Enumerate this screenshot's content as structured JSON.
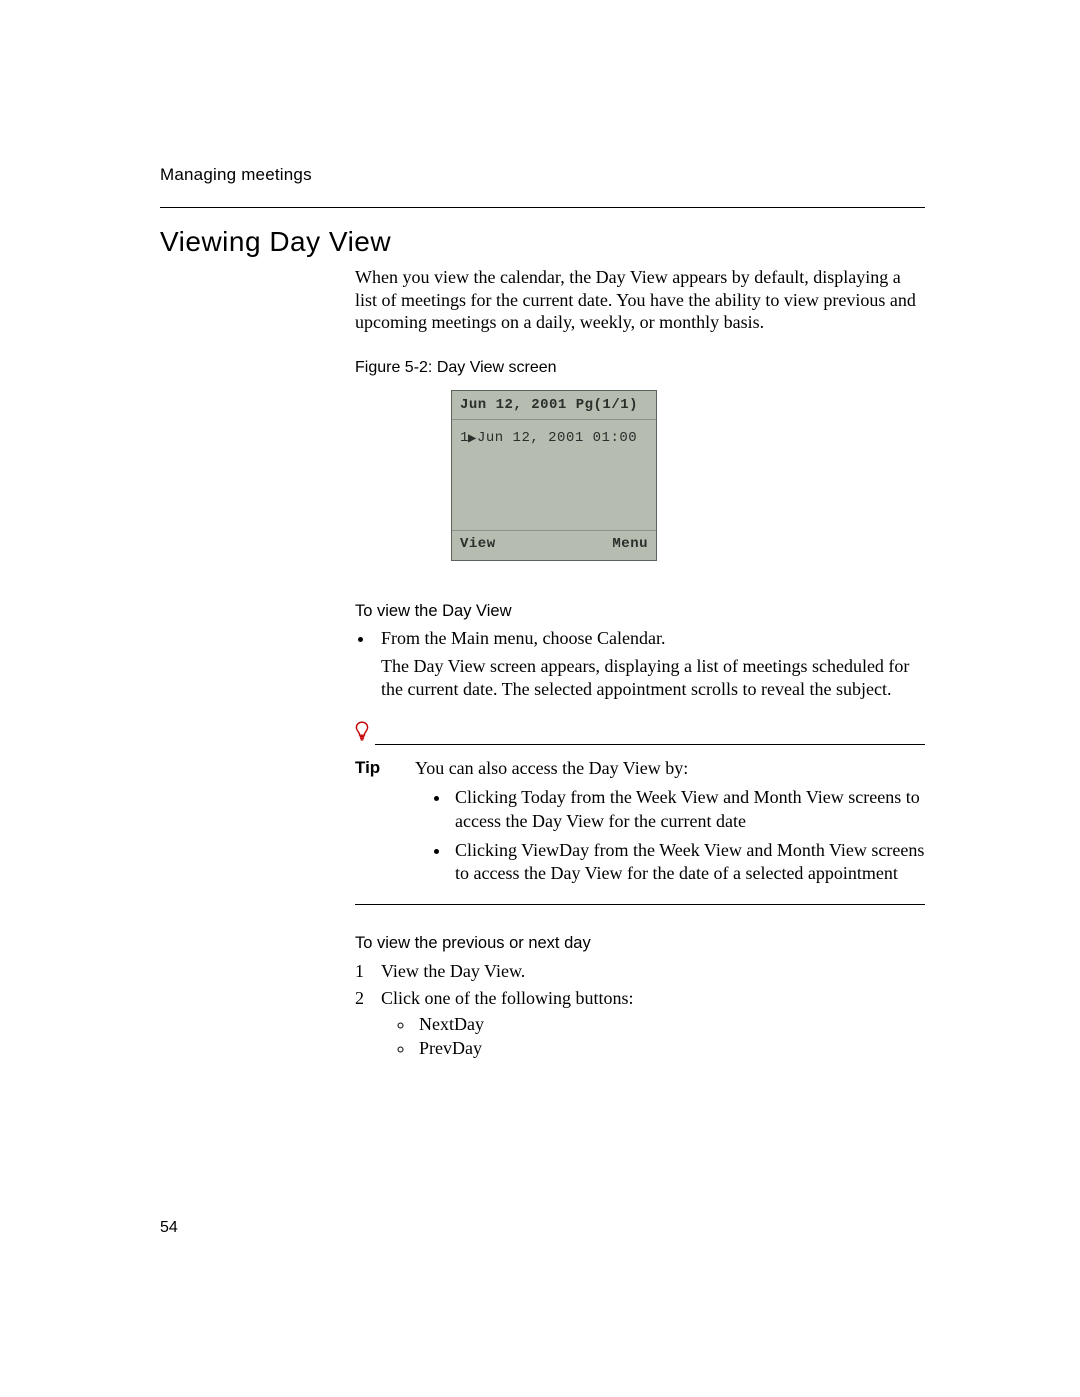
{
  "chapter_header": "Managing meetings",
  "section_title": "Viewing Day View",
  "intro_paragraph": "When you view the calendar, the Day View appears by default, displaying a list of meetings for the current date. You have the ability to view previous and upcoming meetings on a daily, weekly, or monthly basis.",
  "figure_caption": "Figure 5-2: Day View screen",
  "screen": {
    "header": "Jun 12, 2001 Pg(1/1)",
    "row_index": "1",
    "row_cursor": "▶",
    "row_text": "Jun 12, 2001 01:00",
    "foot_left": "View",
    "foot_right": "Menu"
  },
  "procedures": {
    "view_day": {
      "heading": "To view the Day View",
      "bullet1": "From the Main menu, choose Calendar.",
      "description": "The Day View screen appears, displaying a list of meetings scheduled for the current date. The selected appointment scrolls to reveal the subject."
    },
    "tip": {
      "label": "Tip",
      "lead": "You can also access the Day View by:",
      "item1": "Clicking Today from the Week View and Month View screens to access the Day View for the current date",
      "item2": "Clicking ViewDay from the Week View and Month View screens to access the Day View for the date of a selected appointment"
    },
    "prev_next": {
      "heading": "To view the previous or next day",
      "step1": "View the Day View.",
      "step2": "Click one of the following buttons:",
      "sub1": "NextDay",
      "sub2": "PrevDay"
    }
  },
  "page_number": "54"
}
